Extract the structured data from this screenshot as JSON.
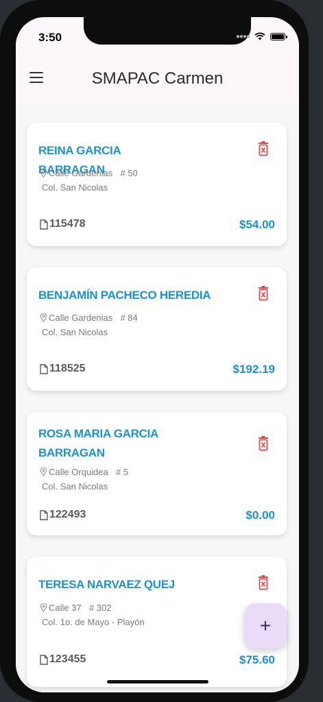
{
  "status": {
    "time": "3:50"
  },
  "appbar": {
    "title": "SMAPAC Carmen",
    "menu_icon": "menu-icon"
  },
  "colors": {
    "accent": "#1a92d2",
    "danger": "#e0474c",
    "appbar_bg": "#fdf6fb",
    "fab_bg": "#eadcf8"
  },
  "cards": [
    {
      "name": "REINA GARCIA BARRAGAN",
      "street": "Calle Gardenias",
      "number": "# 50",
      "colonia": "Col. San Nicolas",
      "account": "115478",
      "amount": "$54.00"
    },
    {
      "name": "BENJAMÍN PACHECO HEREDIA",
      "street": "Calle Gardenias",
      "number": "# 84",
      "colonia": "Col. San Nicolas",
      "account": "118525",
      "amount": "$192.19"
    },
    {
      "name": "ROSA MARIA GARCIA BARRAGAN",
      "street": "Calle Orquidea",
      "number": "# 5",
      "colonia": "Col. San Nicolas",
      "account": "122493",
      "amount": "$0.00"
    },
    {
      "name": "TERESA NARVAEZ QUEJ",
      "street": "Calle 37",
      "number": "# 302",
      "colonia": "Col. 1o. de Mayo - Playón",
      "account": "123455",
      "amount": "$75.60"
    }
  ],
  "fab": {
    "label": "+"
  }
}
